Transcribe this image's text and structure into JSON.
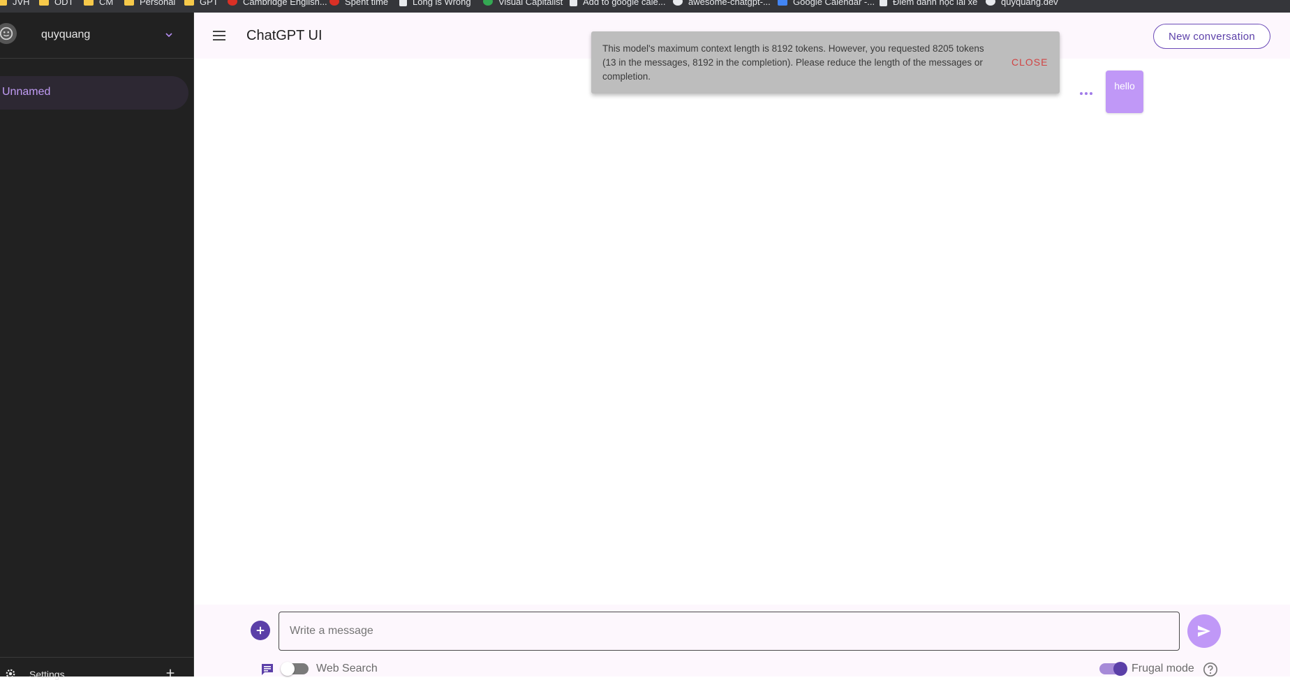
{
  "bookmarks": [
    {
      "label": "JVH",
      "icon": "folder-icon"
    },
    {
      "label": "ODT",
      "icon": "folder-icon"
    },
    {
      "label": "CM",
      "icon": "folder-icon"
    },
    {
      "label": "Personal",
      "icon": "folder-icon"
    },
    {
      "label": "GPT",
      "icon": "folder-icon"
    },
    {
      "label": "Cambridge English...",
      "icon": "site-icon"
    },
    {
      "label": "Spent time",
      "icon": "site-icon"
    },
    {
      "label": "Long is Wrong",
      "icon": "doc-icon"
    },
    {
      "label": "Visual Capitalist",
      "icon": "site-icon"
    },
    {
      "label": "Add to google cale...",
      "icon": "doc-icon"
    },
    {
      "label": "awesome-chatgpt-...",
      "icon": "github-icon"
    },
    {
      "label": "Google Calendar -...",
      "icon": "calendar-icon"
    },
    {
      "label": "Điểm danh học lái xe",
      "icon": "doc-icon"
    },
    {
      "label": "quyquang.dev",
      "icon": "github-icon"
    }
  ],
  "sidebar": {
    "username": "quyquang",
    "conversations": [
      {
        "label": "Unnamed",
        "active": true
      }
    ],
    "settings_label": "Settings"
  },
  "header": {
    "title": "ChatGPT UI",
    "new_conversation_label": "New conversation"
  },
  "snackbar": {
    "message": "This model's maximum context length is 8192 tokens. However, you requested 8205 tokens (13 in the messages, 8192 in the completion). Please reduce the length of the messages or completion.",
    "close_label": "CLOSE"
  },
  "messages": [
    {
      "role": "user",
      "text": "hello"
    }
  ],
  "composer": {
    "placeholder": "Write a message",
    "value": "",
    "web_search_label": "Web Search",
    "web_search_enabled": false,
    "frugal_mode_label": "Frugal mode",
    "frugal_mode_enabled": true
  },
  "colors": {
    "accent": "#5b3fa8",
    "bubble": "#c098f7",
    "sidebar_bg": "#212121",
    "active_item_text": "#c19cf5",
    "snackbar_bg": "#bdbdbd",
    "close_text": "#d14343"
  }
}
